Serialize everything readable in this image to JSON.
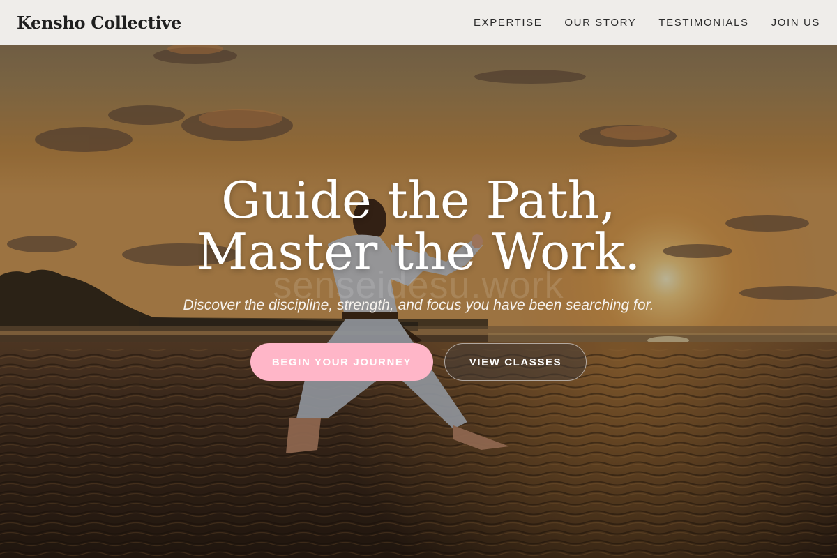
{
  "navbar": {
    "brand": "Kensho Collective",
    "links": [
      {
        "label": "EXPERTISE"
      },
      {
        "label": "OUR STORY"
      },
      {
        "label": "TESTIMONIALS"
      },
      {
        "label": "JOIN US"
      }
    ]
  },
  "hero": {
    "title": "Guide the Path, Master the Work.",
    "watermark": "senseidesu.work",
    "subtitle": "Discover the discipline, strength, and focus you have been searching for.",
    "primary_button": "BEGIN YOUR JOURNEY",
    "secondary_button": "VIEW CLASSES",
    "background_image": "karate practitioner on beach at sunset",
    "colors": {
      "primary_button": "#ffb6c8",
      "navbar_bg": "#f4f2f0",
      "text_light": "#ffffff"
    }
  }
}
